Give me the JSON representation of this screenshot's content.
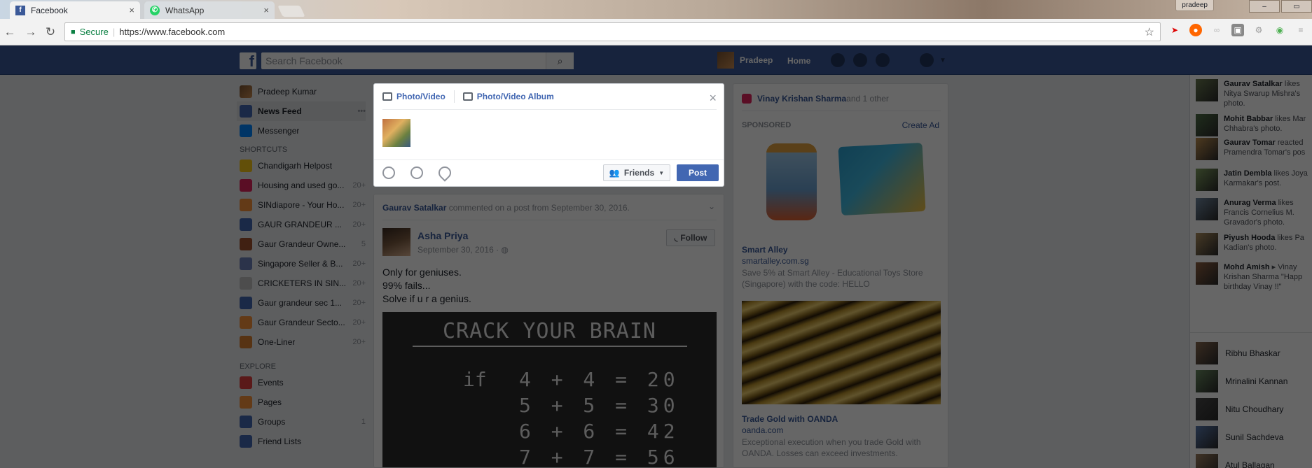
{
  "browser": {
    "tabs": [
      {
        "label": "Facebook",
        "close": "×"
      },
      {
        "label": "WhatsApp",
        "close": "×"
      }
    ],
    "user_chip": "pradeep",
    "secure_label": "Secure",
    "url": "https://www.facebook.com"
  },
  "header": {
    "logo": "f",
    "search_placeholder": "Search Facebook",
    "user_name": "Pradeep",
    "home_label": "Home"
  },
  "leftnav": {
    "profile": "Pradeep Kumar",
    "main": [
      {
        "label": "News Feed",
        "count": ""
      },
      {
        "label": "Messenger",
        "count": ""
      }
    ],
    "shortcuts_title": "SHORTCUTS",
    "shortcuts": [
      {
        "label": "Chandigarh Helpost",
        "count": ""
      },
      {
        "label": "Housing and used go...",
        "count": "20+"
      },
      {
        "label": "SINdiapore - Your Ho...",
        "count": "20+"
      },
      {
        "label": "GAUR GRANDEUR ...",
        "count": "20+"
      },
      {
        "label": "Gaur Grandeur Owne...",
        "count": "5"
      },
      {
        "label": "Singapore Seller & B...",
        "count": "20+"
      },
      {
        "label": "CRICKETERS IN SIN...",
        "count": "20+"
      },
      {
        "label": "Gaur grandeur sec 1...",
        "count": "20+"
      },
      {
        "label": "Gaur Grandeur Secto...",
        "count": "20+"
      },
      {
        "label": "One-Liner",
        "count": "20+"
      }
    ],
    "explore_title": "EXPLORE",
    "explore": [
      {
        "label": "Events",
        "count": ""
      },
      {
        "label": "Pages",
        "count": ""
      },
      {
        "label": "Groups",
        "count": "1"
      },
      {
        "label": "Friend Lists",
        "count": ""
      }
    ],
    "colors": [
      "#f5c518",
      "#e0245e",
      "#f7923a",
      "#4267b2",
      "#a0522d",
      "#6b7fb8",
      "#c0c0c0",
      "#4267b2",
      "#f7923a",
      "#d98030"
    ]
  },
  "composer": {
    "tab_photo": "Photo/Video",
    "tab_album": "Photo/Video Album",
    "close": "×",
    "audience": "Friends",
    "post": "Post"
  },
  "story": {
    "header_actor": "Gaurav Satalkar",
    "header_rest": " commented on a post from September 30, 2016.",
    "author": "Asha Priya",
    "time": "September 30, 2016 · ",
    "follow": "Follow",
    "lines": [
      "Only for geniuses.",
      "99% fails...",
      "Solve if u r a genius."
    ],
    "puzzle_title": "CRACK YOUR BRAIN",
    "puzzle_if": "if",
    "equations": [
      "4 + 4 = 20",
      "5 + 5 = 30",
      "6 + 6 = 42",
      "7 + 7 = 56"
    ]
  },
  "rightcol": {
    "bday_name": "Vinay Krishan Sharma",
    "bday_rest": " and 1 other",
    "sponsored": "SPONSORED",
    "create_ad": "Create Ad",
    "ad1": {
      "title": "Smart Alley",
      "url": "smartalley.com.sg",
      "desc": "Save 5% at Smart Alley - Educational Toys Store (Singapore) with the code: HELLO"
    },
    "ad2": {
      "title": "Trade Gold with OANDA",
      "url": "oanda.com",
      "desc": "Exceptional execution when you trade Gold with OANDA. Losses can exceed investments."
    }
  },
  "ticker": [
    {
      "name": "Gaurav Satalkar",
      "line1": " likes",
      "line2": "Nitya Swarup Mishra's",
      "line3": "photo."
    },
    {
      "name": "Mohit Babbar",
      "line1": " likes Mar",
      "line2": "Chhabra's photo.",
      "line3": ""
    },
    {
      "name": "Gaurav Tomar",
      "line1": " reacted",
      "line2": "Pramendra Tomar's pos",
      "line3": ""
    },
    {
      "name": "Jatin Dembla",
      "line1": " likes Joya",
      "line2": "Karmakar's post.",
      "line3": ""
    },
    {
      "name": "Anurag Verma",
      "line1": " likes",
      "line2": "Francis Cornelius M.",
      "line3": "Gravador's photo."
    },
    {
      "name": "Piyush Hooda",
      "line1": " likes Pa",
      "line2": "Kadian's photo.",
      "line3": ""
    },
    {
      "name": "Mohd Amish",
      "line1": " ▸ Vinay",
      "line2": "Krishan Sharma \"Happ",
      "line3": "birthday Vinay !!\""
    }
  ],
  "chat": [
    "Ribhu Bhaskar",
    "Mrinalini Kannan",
    "Nitu Choudhary",
    "Sunil Sachdeva",
    "Atul Ballagan"
  ]
}
